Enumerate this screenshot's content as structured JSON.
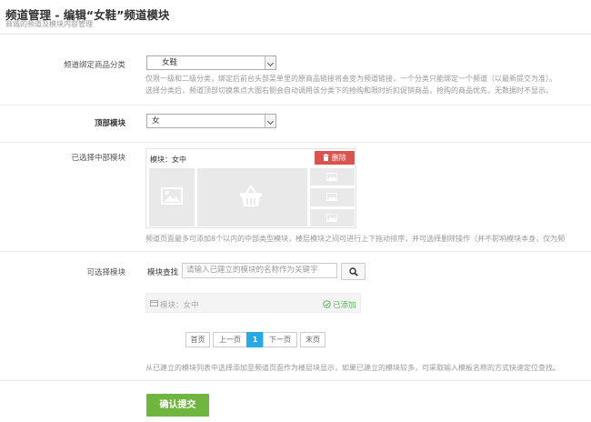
{
  "header": {
    "title": "频道管理 - 编辑“女鞋”频道模块",
    "subtitle": "商城的频道及模块内容管理"
  },
  "category_row": {
    "label": "频道绑定商品分类",
    "selected": "女鞋",
    "help_line1": "仅限一级和二级分类，绑定后前台头部菜单里的原商品链接将会变为频道链接，一个分类只能绑定一个频道（以最新提交为准）。",
    "help_line2": "选择分类后，频道顶部切换焦点大图右侧会自动调用该分类下的抢购和限时折扣促销商品，抢购的商品优先，无数据时不显示。"
  },
  "top_module_row": {
    "label": "顶部模块",
    "selected": "女"
  },
  "selected_mid_row": {
    "label": "已选择中部模块",
    "card_title": "模块：女中",
    "delete_label": "删除",
    "help": "频道页面最多可添加8个以内的中部类型模块，楼层模块之间可进行上下拖动排序，并可选择删除操作（并不影响模块本身，仅为频"
  },
  "available_row": {
    "label": "可选择模块",
    "search_label": "模块查找",
    "search_placeholder": "请输入已建立的模块的名称作为关键字",
    "result_label": "模块：女中",
    "result_status": "已添加",
    "pager": {
      "first": "首页",
      "prev": "上一页",
      "current": "1",
      "next": "下一页",
      "last": "末页"
    },
    "help": "从已建立的模块列表中选择添加至频道页面作为楼层块显示，如果已建立的模块较多，可采取输入模板名称的方式快速定位查找。"
  },
  "submit_label": "确认提交",
  "colors": {
    "delete": "#d9534f",
    "submit": "#70b540",
    "pager_active": "#27a9e3",
    "added": "#5cb85c"
  }
}
